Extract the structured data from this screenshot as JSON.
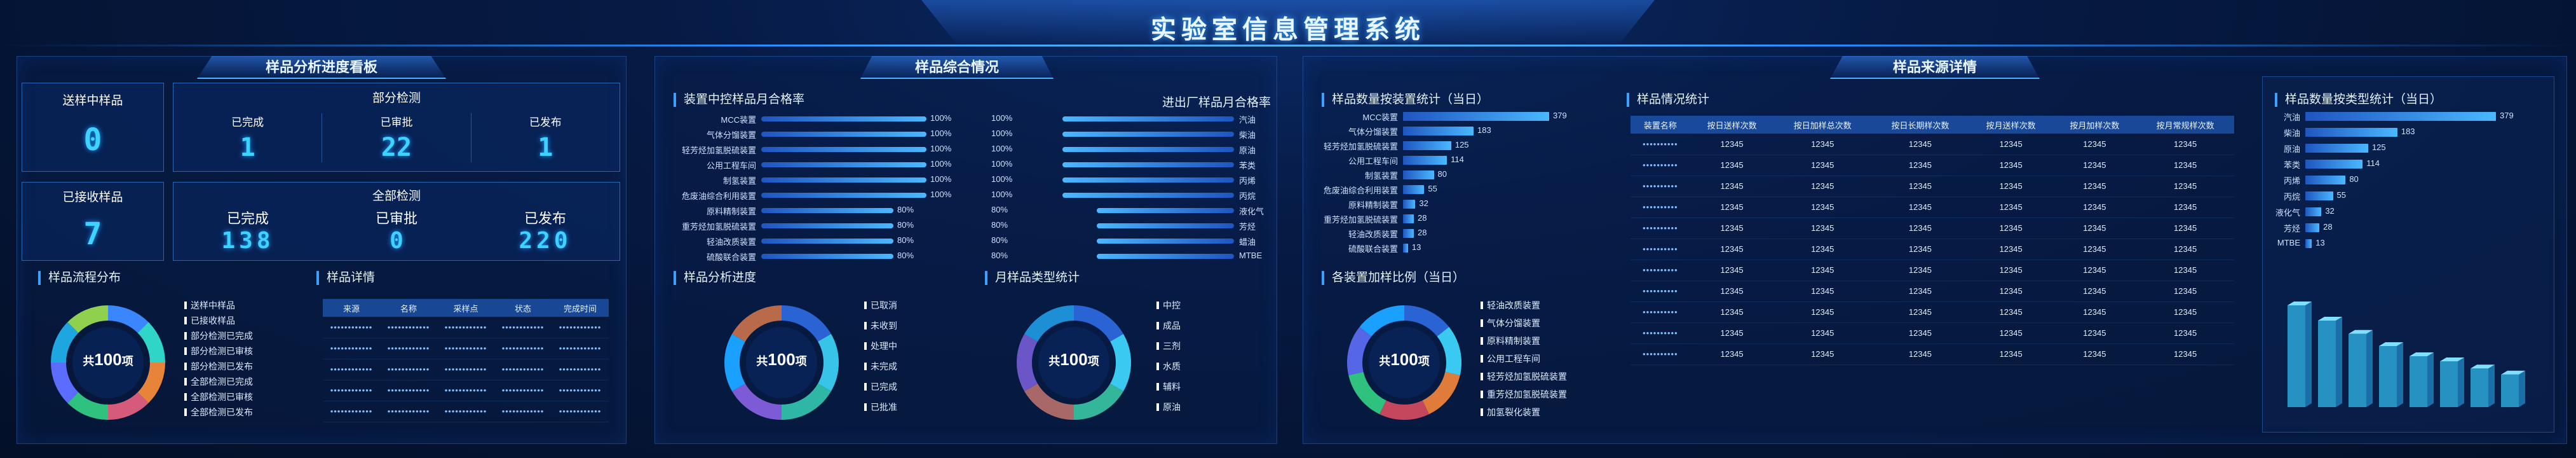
{
  "header": {
    "title": "实验室信息管理系统"
  },
  "sections": {
    "progress": "样品分析进度看板",
    "overall": "样品综合情况",
    "source": "样品来源详情"
  },
  "progress_board": {
    "sending": {
      "label": "送样中样品",
      "value": "0"
    },
    "received": {
      "label": "已接收样品",
      "value": "7"
    },
    "partial": {
      "label": "部分检测",
      "items": [
        {
          "label": "已完成",
          "value": "1"
        },
        {
          "label": "已审批",
          "value": "22"
        },
        {
          "label": "已发布",
          "value": "1"
        }
      ]
    },
    "all": {
      "label": "全部检测",
      "items": [
        {
          "label": "已完成",
          "value": "138"
        },
        {
          "label": "已审批",
          "value": "0"
        },
        {
          "label": "已发布",
          "value": "220"
        }
      ]
    }
  },
  "flow": {
    "title": "样品流程分布",
    "center_prefix": "共",
    "center_value": "100",
    "center_unit": "项",
    "legend": [
      "送样中样品",
      "已接收样品",
      "部分检测已完成",
      "部分检测已审核",
      "部分检测已发布",
      "全部检测已完成",
      "全部检测已审核",
      "全部检测已发布"
    ],
    "colors": [
      "#3a86ff",
      "#2fd6c8",
      "#e8843a",
      "#d65a7a",
      "#2ec27e",
      "#5b6cff",
      "#1da6e0",
      "#8fd14f"
    ]
  },
  "detail": {
    "title": "样品详情",
    "columns": [
      "来源",
      "名称",
      "采样点",
      "状态",
      "完成时间"
    ],
    "rows": 5,
    "placeholder": "••••••••••••"
  },
  "device_pass": {
    "title": "装置中控样品月合格率",
    "items": [
      {
        "name": "MCC装置",
        "value": 100,
        "label": "100%"
      },
      {
        "name": "气体分馏装置",
        "value": 100,
        "label": "100%"
      },
      {
        "name": "轻芳烃加氢脱硫装置",
        "value": 100,
        "label": "100%"
      },
      {
        "name": "公用工程车间",
        "value": 100,
        "label": "100%"
      },
      {
        "name": "制氢装置",
        "value": 100,
        "label": "100%"
      },
      {
        "name": "危废油综合利用装置",
        "value": 100,
        "label": "100%"
      },
      {
        "name": "原料精制装置",
        "value": 80,
        "label": "80%"
      },
      {
        "name": "重芳烃加氢脱硫装置",
        "value": 80,
        "label": "80%"
      },
      {
        "name": "轻油改质装置",
        "value": 80,
        "label": "80%"
      },
      {
        "name": "硫酸联合装置",
        "value": 80,
        "label": "80%"
      }
    ]
  },
  "inout_pass": {
    "title": "进出厂样品月合格率",
    "items": [
      {
        "name": "汽油",
        "value": 100,
        "label": "100%"
      },
      {
        "name": "柴油",
        "value": 100,
        "label": "100%"
      },
      {
        "name": "原油",
        "value": 100,
        "label": "100%"
      },
      {
        "name": "苯类",
        "value": 100,
        "label": "100%"
      },
      {
        "name": "丙烯",
        "value": 100,
        "label": "100%"
      },
      {
        "name": "丙烷",
        "value": 100,
        "label": "100%"
      },
      {
        "name": "液化气",
        "value": 80,
        "label": "80%"
      },
      {
        "name": "芳烃",
        "value": 80,
        "label": "80%"
      },
      {
        "name": "蜡油",
        "value": 80,
        "label": "80%"
      },
      {
        "name": "MTBE",
        "value": 80,
        "label": "80%"
      }
    ]
  },
  "analysis_progress": {
    "title": "样品分析进度",
    "center_prefix": "共",
    "center_value": "100",
    "center_unit": "项",
    "legend": [
      "已取消",
      "未收到",
      "处理中",
      "未完成",
      "已完成",
      "已批准"
    ],
    "colors": [
      "#2a63d4",
      "#38c3e8",
      "#2fb7a6",
      "#7d5bd6",
      "#1aa0ff",
      "#b86a4a"
    ]
  },
  "month_type": {
    "title": "月样品类型统计",
    "center_prefix": "共",
    "center_value": "100",
    "center_unit": "项",
    "legend": [
      "中控",
      "成品",
      "三剂",
      "水质",
      "辅料",
      "原油"
    ],
    "colors": [
      "#2a63d4",
      "#3ac9f0",
      "#33b69a",
      "#a86868",
      "#6b56c8",
      "#1d8fd6"
    ]
  },
  "device_count": {
    "title": "样品数量按装置统计（当日）",
    "items": [
      {
        "name": "MCC装置",
        "value": 379
      },
      {
        "name": "气体分馏装置",
        "value": 183
      },
      {
        "name": "轻芳烃加氢脱硫装置",
        "value": 125
      },
      {
        "name": "公用工程车间",
        "value": 114
      },
      {
        "name": "制氢装置",
        "value": 80
      },
      {
        "name": "危废油综合利用装置",
        "value": 55
      },
      {
        "name": "原料精制装置",
        "value": 32
      },
      {
        "name": "重芳烃加氢脱硫装置",
        "value": 28
      },
      {
        "name": "轻油改质装置",
        "value": 28
      },
      {
        "name": "硫酸联合装置",
        "value": 13
      }
    ],
    "max": 379
  },
  "device_ratio": {
    "title": "各装置加样比例（当日）",
    "center_prefix": "共",
    "center_value": "100",
    "center_unit": "项",
    "legend": [
      "轻油改质装置",
      "气体分馏装置",
      "原料精制装置",
      "公用工程车间",
      "轻芳烃加氢脱硫装置",
      "重芳烃加氢脱硫装置",
      "加氢裂化装置"
    ],
    "colors": [
      "#2a63d4",
      "#3ac9f0",
      "#e07c3a",
      "#c4475e",
      "#2ec27e",
      "#5566e6",
      "#1aa0ff"
    ]
  },
  "source_table": {
    "title": "样品情况统计",
    "columns": [
      "装置名称",
      "按日送样次数",
      "按日加样总次数",
      "按日长期样次数",
      "按月送样次数",
      "按月加样次数",
      "按月常规样次数"
    ],
    "name_placeholder": "••••••••••",
    "value": "12345",
    "rows": 11
  },
  "type_count": {
    "title": "样品数量按类型统计（当日）",
    "items": [
      {
        "name": "汽油",
        "value": 379
      },
      {
        "name": "柴油",
        "value": 183
      },
      {
        "name": "原油",
        "value": 125
      },
      {
        "name": "苯类",
        "value": 114
      },
      {
        "name": "丙烯",
        "value": 80
      },
      {
        "name": "丙烷",
        "value": 55
      },
      {
        "name": "液化气",
        "value": 32
      },
      {
        "name": "芳烃",
        "value": 28
      },
      {
        "name": "MTBE",
        "value": 13
      }
    ],
    "max": 379,
    "bar3d": [
      100,
      85,
      72,
      60,
      50,
      45,
      38,
      32
    ]
  }
}
